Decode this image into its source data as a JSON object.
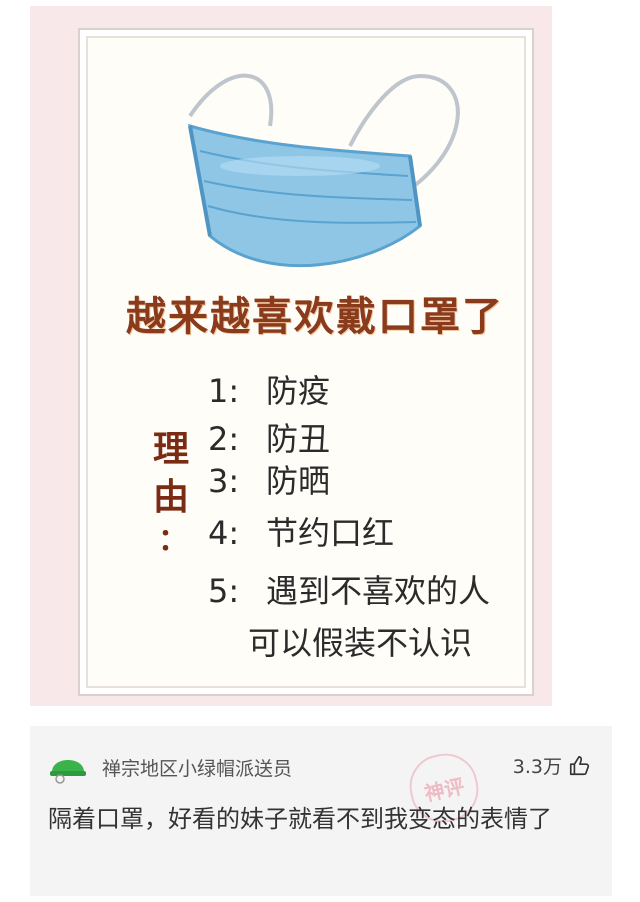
{
  "poster": {
    "title": "越来越喜欢戴口罩了",
    "reason_label": "理由",
    "reason_colon": "：",
    "items": [
      {
        "num": "1:",
        "text": "防疫"
      },
      {
        "num": "2:",
        "text": "防丑"
      },
      {
        "num": "3:",
        "text": "防晒"
      },
      {
        "num": "4:",
        "text": "节约口红"
      },
      {
        "num": "5:",
        "text": "遇到不喜欢的人"
      },
      {
        "num": "",
        "text": "可以假装不认识"
      }
    ]
  },
  "comment": {
    "username": "禅宗地区小绿帽派送员",
    "likes": "3.3万",
    "text": "隔着口罩，好看的妹子就看不到我变态的表情了",
    "watermark": "神评",
    "avatar_icon": "green-helmet-avatar",
    "like_icon": "thumbs-up-icon"
  },
  "colors": {
    "title": "#8a3b1c",
    "background_pink": "#f9e8ea",
    "comment_bg": "#f4f4f4"
  }
}
